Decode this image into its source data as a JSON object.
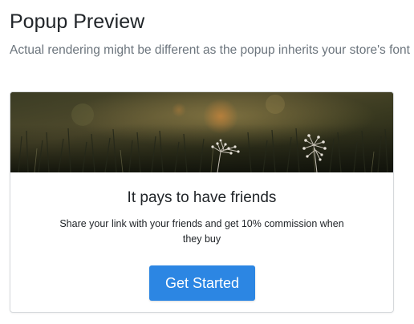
{
  "page": {
    "title": "Popup Preview",
    "subtitle": "Actual rendering might be different as the popup inherits your store's font"
  },
  "popup": {
    "banner_image": "meadow-wildflowers-photo",
    "heading": "It pays to have friends",
    "body": "Share your link with your friends and get 10% commission when they buy",
    "cta_label": "Get Started"
  },
  "colors": {
    "cta_background": "#2c86e3",
    "subtitle_text": "#6c757d",
    "card_border": "#d6d9dc"
  }
}
